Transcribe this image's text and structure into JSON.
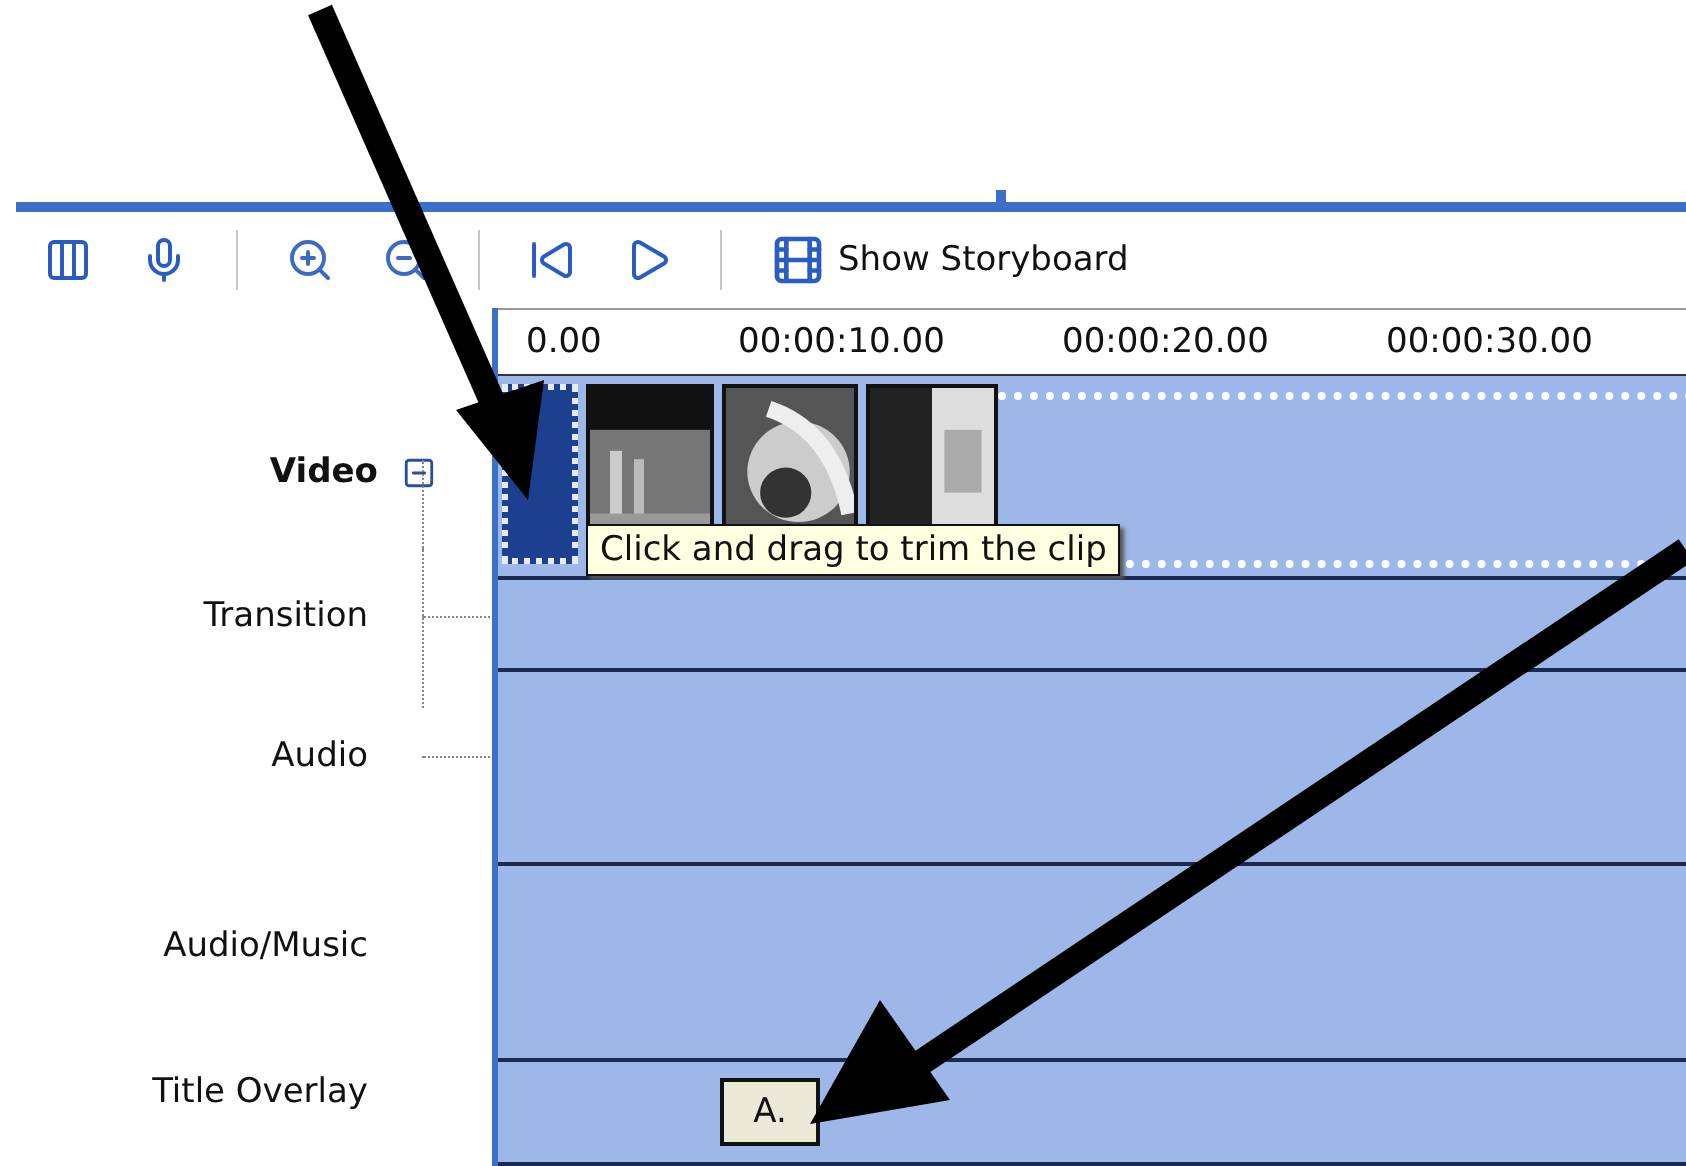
{
  "toolbar": {
    "buttons": [
      {
        "kind": "timeline"
      },
      {
        "kind": "narrate"
      },
      {
        "kind": "zoom-in"
      },
      {
        "kind": "zoom-out"
      },
      {
        "kind": "rewind"
      },
      {
        "kind": "play"
      }
    ],
    "storyboard_button": "Show Storyboard"
  },
  "ruler": {
    "ticks": [
      "0.00",
      "00:00:10.00",
      "00:00:20.00",
      "00:00:30.00"
    ]
  },
  "tracks": [
    {
      "label": "Video",
      "kind": "main",
      "expanded": true
    },
    {
      "label": "Transition",
      "kind": "sub"
    },
    {
      "label": "Audio",
      "kind": "sub"
    },
    {
      "label": "Audio/Music",
      "kind": "plain"
    },
    {
      "label": "Title Overlay",
      "kind": "plain"
    }
  ],
  "video_clips": [
    {
      "selected": true
    },
    {
      "selected": false
    },
    {
      "selected": false
    },
    {
      "selected": false
    }
  ],
  "tooltip": "Click and drag to trim the clip",
  "title_clip": "A."
}
